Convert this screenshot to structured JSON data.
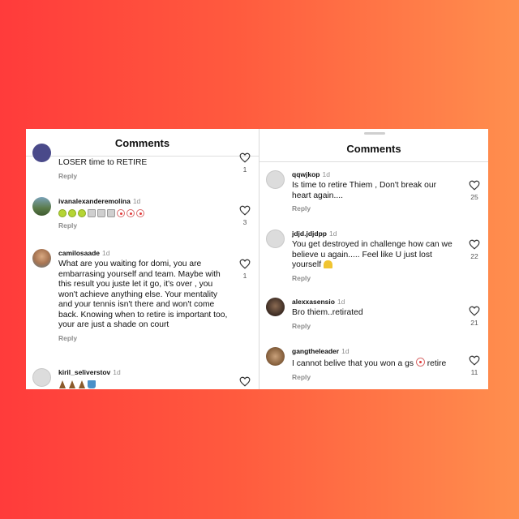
{
  "left_panel": {
    "title": "Comments",
    "comments": [
      {
        "username": "",
        "time": "",
        "text": "LOSER time to RETIRE",
        "reply": "Reply",
        "likes": "1"
      },
      {
        "username": "ivanalexanderemolina",
        "time": "1d",
        "text": "",
        "emojis": [
          "tennis-ball",
          "tennis-ball",
          "tennis-ball",
          "trash-can",
          "trash-can",
          "trash-can",
          "clown-face",
          "clown-face",
          "clown-face"
        ],
        "reply": "Reply",
        "likes": "3"
      },
      {
        "username": "camilosaade",
        "time": "1d",
        "text": "What are you waiting for domi, you are embarrasing yourself and team. Maybe with this result you juste let it go, it's over , you won't achieve anything else. Your mentality and your tennis isn't there and won't come back. Knowing when to retire is important too, your are just a shade on court",
        "reply": "Reply",
        "likes": "1"
      },
      {
        "username": "kiril_seliverstov",
        "time": "1d",
        "text": "",
        "emojis": [
          "pile-of-poo",
          "pile-of-poo",
          "pile-of-poo",
          "cup"
        ],
        "reply": "",
        "likes": ""
      }
    ]
  },
  "right_panel": {
    "title": "Comments",
    "comments": [
      {
        "username": "qqwjkop",
        "time": "1d",
        "text": "Is time to retire Thiem , Don't break our heart again....",
        "reply": "Reply",
        "likes": "25"
      },
      {
        "username": "jdjd.jdjdpp",
        "time": "1d",
        "text": "You get destroyed in challenge how can we believe u again..... Feel like U just lost yourself",
        "trailing_emoji": "construction-worker",
        "reply": "Reply",
        "likes": "22"
      },
      {
        "username": "alexxasensio",
        "time": "1d",
        "text": "Bro thiem..retirated",
        "reply": "Reply",
        "likes": "21"
      },
      {
        "username": "gangtheleader",
        "time": "1d",
        "text_before": "I cannot belive that you won a gs",
        "inline_emoji": "clown-face",
        "text_after": "retire",
        "reply": "Reply",
        "likes": "11"
      }
    ]
  },
  "colors": {
    "background_left": "#ff3b3b",
    "background_right": "#ff8f4e",
    "panel": "#ffffff",
    "secondary_text": "#8e8e8e"
  }
}
